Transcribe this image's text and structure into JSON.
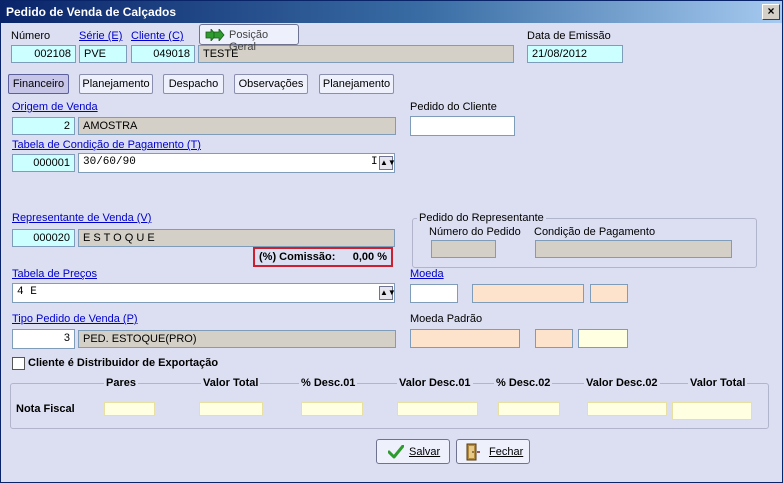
{
  "window": {
    "title": "Pedido de Venda de Calçados",
    "close": "×"
  },
  "header": {
    "numero_label": "Número",
    "numero_value": "002108",
    "serie_label": "Série (E)",
    "serie_value": "PVE",
    "cliente_label": "Cliente (C)",
    "cliente_code": "049018",
    "cliente_name": "TESTE",
    "posicao_label": "Posição Geral",
    "data_label": "Data de Emissão",
    "data_value": "21/08/2012"
  },
  "tabs": [
    "Financeiro",
    "Planejamento",
    "Despacho",
    "Observações",
    "Planejamento"
  ],
  "origem": {
    "label": "Origem de Venda",
    "code": "2",
    "name": "AMOSTRA"
  },
  "pedido_cliente": {
    "label": "Pedido do Cliente",
    "value": ""
  },
  "condicao": {
    "label": "Tabela de Condição de Pagamento (T)",
    "code": "000001",
    "value": "30/60/90",
    "suffix": "I"
  },
  "representante": {
    "label": "Representante de Venda (V)",
    "code": "000020",
    "name": "E S T O Q U E"
  },
  "pedido_rep": {
    "title": "Pedido do Representante",
    "numero_label": "Número do Pedido",
    "cond_label": "Condição de Pagamento"
  },
  "comissao": {
    "label": "(%) Comissão:",
    "value": "0,00 %"
  },
  "precos": {
    "label": "Tabela de Preços",
    "value": "4 E"
  },
  "moeda": {
    "label": "Moeda"
  },
  "tipo_pedido": {
    "label": "Tipo Pedido de Venda (P)",
    "code": "3",
    "name": "PED. ESTOQUE(PRO)"
  },
  "moeda_padrao": {
    "label": "Moeda Padrão"
  },
  "exportacao": {
    "label": "Cliente é Distribuidor de Exportação",
    "checked": false
  },
  "nota": {
    "row_label": "Nota Fiscal",
    "columns": [
      "Pares",
      "Valor Total",
      "% Desc.01",
      "Valor Desc.01",
      "% Desc.02",
      "Valor Desc.02",
      "Valor Total"
    ]
  },
  "buttons": {
    "salvar": "Salvar",
    "fechar": "Fechar"
  },
  "icons": {
    "posicao": "green-double-arrow-icon",
    "salvar": "check-icon",
    "fechar": "door-exit-icon"
  },
  "colors": {
    "title_start": "#0a246a",
    "window_bg": "#dcdff2",
    "comissao_border": "#cc1f2f",
    "check": "#2e9b2e"
  }
}
